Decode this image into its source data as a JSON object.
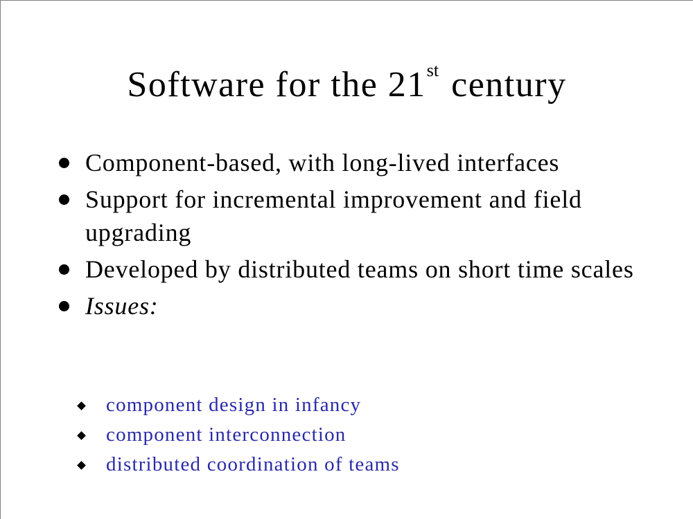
{
  "slide": {
    "title": {
      "main": "Software for the 21",
      "superscript": "st",
      "tail": "century"
    },
    "bullets": [
      {
        "text": "Component-based, with long-lived interfaces",
        "italic": false
      },
      {
        "text": "Support for incremental improvement and field upgrading",
        "italic": false
      },
      {
        "text": "Developed by distributed teams on short time scales",
        "italic": false
      },
      {
        "text": "Issues:",
        "italic": true
      }
    ],
    "sub_bullets": [
      "component design in infancy",
      "component interconnection",
      "distributed coordination of teams"
    ],
    "colors": {
      "text": "#000000",
      "sub_bullet_text": "#2a2aa8",
      "background": "#ffffff"
    }
  }
}
